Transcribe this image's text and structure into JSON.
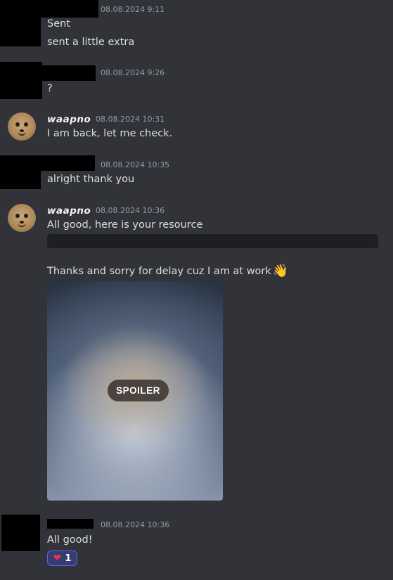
{
  "messages": [
    {
      "id": "m1",
      "timestamp": "08.08.2024 9:11",
      "lines": [
        "Sent",
        "sent a little extra"
      ]
    },
    {
      "id": "m2",
      "timestamp": "08.08.2024 9:26",
      "lines": [
        "?"
      ]
    },
    {
      "id": "m3",
      "author": "waapno",
      "timestamp": "08.08.2024 10:31",
      "lines": [
        "I am back, let me check."
      ]
    },
    {
      "id": "m4",
      "timestamp": "08.08.2024 10:35",
      "lines": [
        "alright thank you"
      ]
    },
    {
      "id": "m5",
      "author": "waapno",
      "timestamp": "08.08.2024 10:36",
      "lines": [
        "All good, here is your resource",
        "Thanks and sorry for delay cuz I am at work"
      ],
      "emoji": "👋",
      "spoiler_label": "SPOILER"
    },
    {
      "id": "m6",
      "timestamp": "08.08.2024 10:36",
      "lines": [
        "All good!"
      ],
      "reaction": {
        "emoji": "heart",
        "count": "1"
      }
    }
  ],
  "colors": {
    "background": "#313338",
    "text": "#dbdee1",
    "timestamp": "#949ba4",
    "reaction_border": "#5865f2",
    "heart": "#e8344e"
  },
  "icons": {
    "avatar": "meerkat-avatar",
    "wave": "waving-hand-emoji",
    "reaction": "heart-icon"
  }
}
